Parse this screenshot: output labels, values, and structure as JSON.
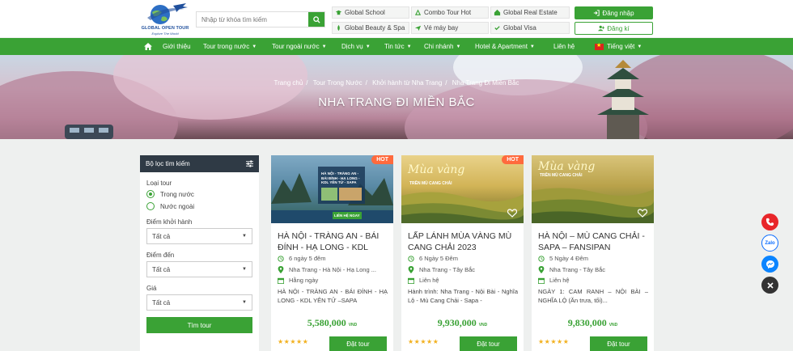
{
  "header": {
    "logo_text": "GLOBAL OPEN TOUR",
    "logo_slogan": "Explore The World",
    "search_placeholder": "Nhập từ khóa tìm kiếm",
    "quick_links": [
      {
        "label": "Global School",
        "icon": "school-icon"
      },
      {
        "label": "Combo Tour Hot",
        "icon": "combo-icon"
      },
      {
        "label": "Global Real Estate",
        "icon": "real-estate-icon"
      },
      {
        "label": "Global Beauty & Spa",
        "icon": "spa-icon"
      },
      {
        "label": "Vé máy bay",
        "icon": "plane-icon"
      },
      {
        "label": "Global Visa",
        "icon": "visa-icon"
      }
    ],
    "login_label": "Đăng nhập",
    "register_label": "Đăng kí"
  },
  "nav": {
    "items": [
      "Giới thiệu",
      "Tour trong nước",
      "Tour ngoài nước",
      "Dịch vụ",
      "Tin tức",
      "Chi nhánh",
      "Hotel & Apartment",
      "Liên hệ"
    ],
    "language": "Tiếng việt"
  },
  "banner": {
    "breadcrumb": [
      "Trang chủ",
      "Tour Trong Nước",
      "Khởi hành từ Nha Trang",
      "Nha Trang Đi Miền Bắc"
    ],
    "title": "NHA TRANG ĐI MIỀN BẮC"
  },
  "filter": {
    "title": "Bộ lọc tìm kiếm",
    "tour_type_label": "Loại tour",
    "tour_types": [
      "Trong nước",
      "Nước ngoài"
    ],
    "selected_tour_type": "Trong nước",
    "departure_label": "Điểm khởi hành",
    "departure_value": "Tất cả",
    "destination_label": "Điểm đến",
    "destination_value": "Tất cả",
    "price_label": "Giá",
    "price_value": "Tất cả",
    "search_label": "Tìm tour"
  },
  "tours": [
    {
      "title": "HÀ NỘI - TRÀNG AN - BÁI ĐÍNH - HẠ LONG - KDL",
      "hot": true,
      "badge": "HOT",
      "img_caption": "HÀ NỘI - TRÀNG AN - BÁI ĐÍNH - HẠ LONG - KDL YÊN TỬ - SAPA",
      "img_contact": "LIÊN HỆ NGAY",
      "duration": "6 ngày 5 đêm",
      "route": "Nha Trang - Hà Nội - Hạ Long ...",
      "schedule": "Hằng ngày",
      "desc": "HÀ NỘI - TRÀNG AN - BÁI ĐÍNH - HẠ LONG - KDL YÊN TỬ –SAPA",
      "price": "5,580,000",
      "currency": "VND",
      "rating": "★★★★★",
      "book_label": "Đặt tour"
    },
    {
      "title": "LẤP LÁNH MÙA VÀNG MÙ CANG CHẢI 2023",
      "hot": true,
      "badge": "HOT",
      "img_caption": "Mùa vàng",
      "img_sub": "TRÊN MÙ CANG CHẢI",
      "duration": "6 Ngày 5 Đêm",
      "route": "Nha Trang - Tây Bắc",
      "schedule": "Liên hệ",
      "desc": "Hành trình: Nha Trang - Nội Bài - Nghĩa Lộ - Mù Cang Chải - Sapa -",
      "price": "9,930,000",
      "currency": "VND",
      "rating": "★★★★★",
      "book_label": "Đặt tour"
    },
    {
      "title": "HÀ NỘI – MÙ CANG CHẢI - SAPA – FANSIPAN",
      "hot": false,
      "badge": "",
      "img_caption": "Mùa vàng",
      "img_sub": "TRÊN MÙ CANG CHẢI",
      "duration": "5 Ngày 4 Đêm",
      "route": "Nha Trang - Tây Bắc",
      "schedule": "Liên hệ",
      "desc": "NGÀY 1: CAM RANH – NỘI BÀI – NGHĨA LỘ (Ăn trưa, tối)...",
      "price": "9,830,000",
      "currency": "VND",
      "rating": "★★★★★",
      "book_label": "Đặt tour"
    }
  ],
  "social": [
    "phone-icon",
    "zalo-icon",
    "messenger-icon",
    "close-icon"
  ],
  "social_zalo_label": "Zalo",
  "colors": {
    "brand_green": "#3aa235",
    "hot_orange": "#ff6a3d",
    "dark_header": "#2f3a45",
    "price_green": "#3aa235"
  }
}
